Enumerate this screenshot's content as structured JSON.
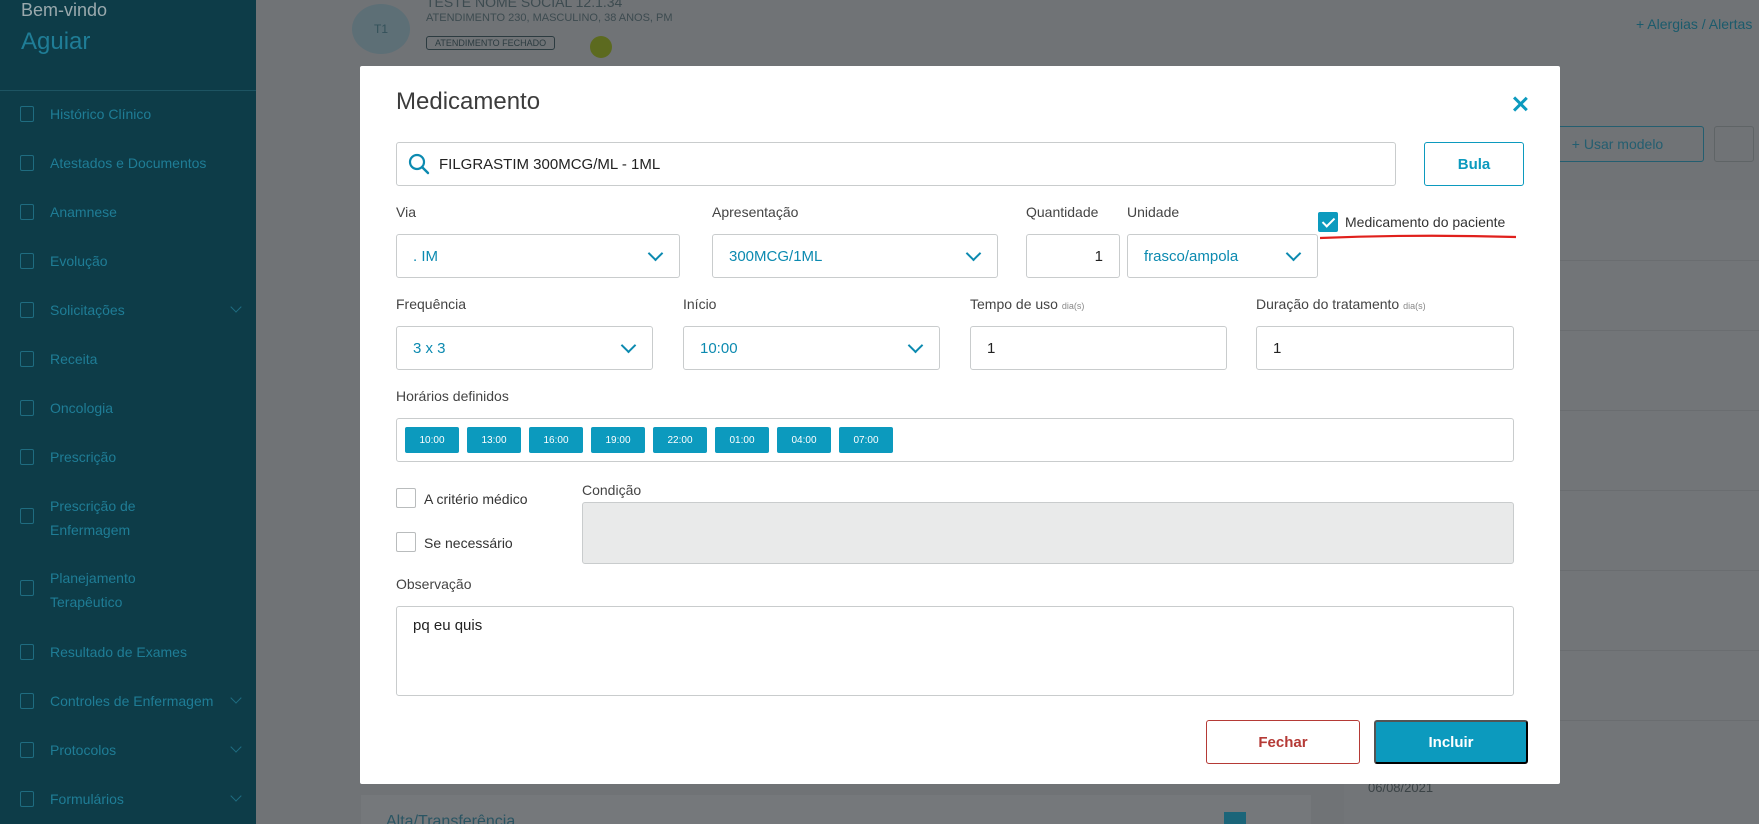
{
  "sidebar": {
    "welcome": "Bem-vindo",
    "username": "Aguiar",
    "items": [
      {
        "label": "Histórico Clínico",
        "icon": "history-icon"
      },
      {
        "label": "Atestados e Documentos",
        "icon": "document-icon"
      },
      {
        "label": "Anamnese",
        "icon": "pencil-icon"
      },
      {
        "label": "Evolução",
        "icon": "pencil-icon"
      },
      {
        "label": "Solicitações",
        "icon": "clipboard-icon"
      },
      {
        "label": "Receita",
        "icon": "document-icon"
      },
      {
        "label": "Oncologia",
        "icon": "document-icon"
      },
      {
        "label": "Prescrição",
        "icon": "document-icon"
      },
      {
        "label": "Prescrição de",
        "label2": "Enfermagem",
        "icon": "document-icon"
      },
      {
        "label": "Planejamento",
        "label2": "Terapêutico",
        "icon": "document-icon"
      },
      {
        "label": "Resultado de Exames",
        "icon": "document-icon"
      },
      {
        "label": "Controles de Enfermagem",
        "icon": "clipboard-icon"
      },
      {
        "label": "Protocolos",
        "icon": "clipboard-icon"
      },
      {
        "label": "Formulários",
        "icon": "list-icon"
      }
    ]
  },
  "patient": {
    "initials": "T1",
    "name": "TESTE NOME SOCIAL 12.1.34",
    "info": "ATENDIMENTO 230, MASCULINO, 38 ANOS, PM",
    "status": "ATENDIMENTO FECHADO"
  },
  "background": {
    "allergies_link": "+ Alergias / Alertas",
    "use_model_button": "+ Usar modelo",
    "date": "06/08/2021",
    "section_title": "Alta/Transferência"
  },
  "modal": {
    "title": "Medicamento",
    "search_value": "FILGRASTIM 300MCG/ML - 1ML",
    "bula_button": "Bula",
    "via": {
      "label": "Via",
      "value": ". IM"
    },
    "apresentacao": {
      "label": "Apresentação",
      "value": "300MCG/1ML"
    },
    "quantidade": {
      "label": "Quantidade",
      "value": "1"
    },
    "unidade": {
      "label": "Unidade",
      "value": "frasco/ampola"
    },
    "patient_med": {
      "label": "Medicamento do paciente",
      "checked": true
    },
    "frequencia": {
      "label": "Frequência",
      "value": "3 x 3"
    },
    "inicio": {
      "label": "Início",
      "value": "10:00"
    },
    "tempo_uso": {
      "label": "Tempo de uso",
      "unit": "dia(s)",
      "value": "1"
    },
    "duracao": {
      "label": "Duração do tratamento",
      "unit": "dia(s)",
      "value": "1"
    },
    "horarios": {
      "label": "Horários definidos",
      "times": [
        "10:00",
        "13:00",
        "16:00",
        "19:00",
        "22:00",
        "01:00",
        "04:00",
        "07:00"
      ]
    },
    "criterio_medico": {
      "label": "A critério médico",
      "checked": false
    },
    "se_necessario": {
      "label": "Se necessário",
      "checked": false
    },
    "condicao": {
      "label": "Condição",
      "value": ""
    },
    "observacao": {
      "label": "Observação",
      "value": "pq eu quis"
    },
    "close_button": "Fechar",
    "include_button": "Incluir"
  },
  "colors": {
    "accent": "#0c9abe",
    "danger": "#b53a36",
    "sidebar_bg": "#0d3c48",
    "annotation_red": "#e0201c"
  }
}
